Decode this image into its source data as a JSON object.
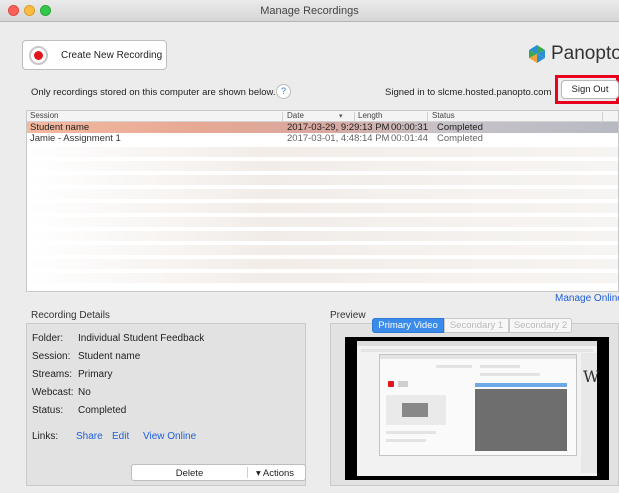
{
  "window": {
    "title": "Manage Recordings"
  },
  "toolbar": {
    "create_label": "Create New Recording",
    "logo_text": "Panopto",
    "logo_colors": [
      "#37a851",
      "#f2a33a",
      "#2b8fd6"
    ]
  },
  "info": {
    "stored_text": "Only recordings stored on this computer are shown below.",
    "help_label": "?",
    "signed_in_text": "Signed in to slcme.hosted.panopto.com",
    "sign_out_label": "Sign Out",
    "highlight_color": "#e8001c"
  },
  "table": {
    "columns": [
      "Session",
      "Date",
      "Length",
      "Status"
    ],
    "sort_column": "Date",
    "sort_icon": "chevron-down-icon",
    "rows": [
      {
        "session": "Student name",
        "date": "2017-03-29, 9:29:13 PM",
        "length": "00:00:31",
        "status": "Completed",
        "selected": true
      },
      {
        "session": "Jamie - Assignment 1",
        "date": "2017-03-01, 4:48:14 PM",
        "length": "00:01:44",
        "status": "Completed",
        "selected": false
      }
    ],
    "selected_row_color": "#f4b89f"
  },
  "details": {
    "title": "Recording Details",
    "fields": [
      {
        "label": "Folder:",
        "value": "Individual Student Feedback"
      },
      {
        "label": "Session:",
        "value": "Student name"
      },
      {
        "label": "Streams:",
        "value": "Primary"
      },
      {
        "label": "Webcast:",
        "value": "No"
      },
      {
        "label": "Status:",
        "value": "Completed"
      }
    ],
    "links_label": "Links:",
    "links": [
      "Share",
      "Edit",
      "View Online"
    ],
    "link_color": "#1f5fd8",
    "delete_label": "Delete",
    "actions_label": "▾ Actions"
  },
  "preview": {
    "manage_online": "Manage Online",
    "title": "Preview",
    "tabs": [
      {
        "label": "Primary Video",
        "active": true
      },
      {
        "label": "Secondary 1",
        "active": false
      },
      {
        "label": "Secondary 2",
        "active": false
      }
    ],
    "accent": "#3a8bea"
  }
}
